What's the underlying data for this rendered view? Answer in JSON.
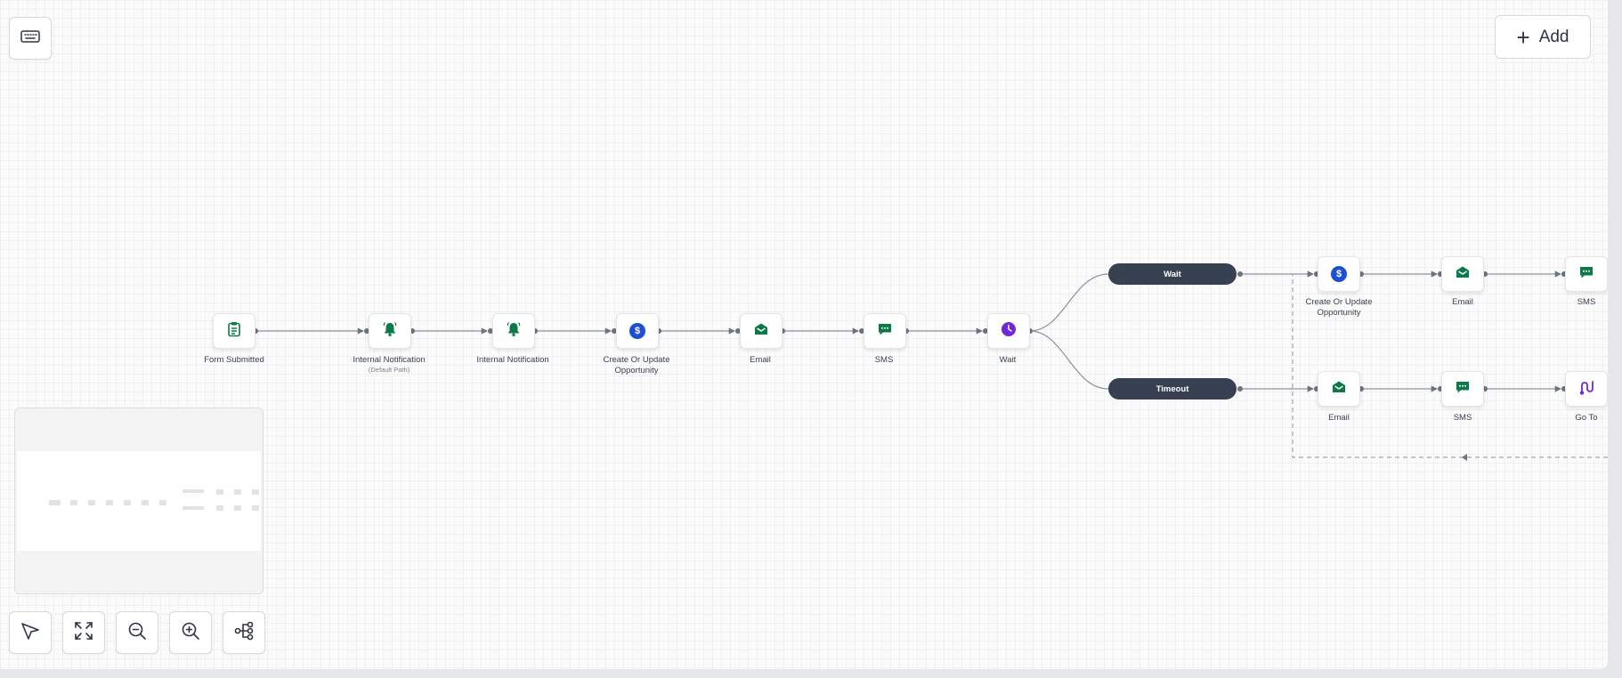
{
  "toolbar": {
    "add_label": "Add"
  },
  "icons": {
    "keyboard": "keyboard-icon",
    "select": "cursor-pointer-icon",
    "fit": "expand-icon",
    "zoom_out": "zoom-out-icon",
    "zoom_in": "zoom-in-icon",
    "layout": "tree-layout-icon"
  },
  "colors": {
    "green": "#0b7a47",
    "blue": "#1d4ed8",
    "purple": "#6d28d9",
    "pill": "#374151"
  },
  "workflow": {
    "nodes": [
      {
        "label": "Form Submitted",
        "icon": "clipboard-icon"
      },
      {
        "label": "Internal Notification",
        "sublabel": "(Default Path)",
        "icon": "bell-icon"
      },
      {
        "label": "Internal Notification",
        "icon": "bell-icon"
      },
      {
        "label": "Create Or Update Opportunity",
        "icon": "dollar-icon"
      },
      {
        "label": "Email",
        "icon": "envelope-icon"
      },
      {
        "label": "SMS",
        "icon": "chat-icon"
      },
      {
        "label": "Wait",
        "icon": "clock-icon"
      }
    ],
    "branches": [
      {
        "label": "Wait",
        "nodes": [
          {
            "label": "Create Or Update Opportunity",
            "icon": "dollar-icon"
          },
          {
            "label": "Email",
            "icon": "envelope-icon"
          },
          {
            "label": "SMS",
            "icon": "chat-icon"
          }
        ]
      },
      {
        "label": "Timeout",
        "nodes": [
          {
            "label": "Email",
            "icon": "envelope-icon"
          },
          {
            "label": "SMS",
            "icon": "chat-icon"
          },
          {
            "label": "Go To",
            "icon": "goto-icon"
          }
        ]
      }
    ]
  }
}
